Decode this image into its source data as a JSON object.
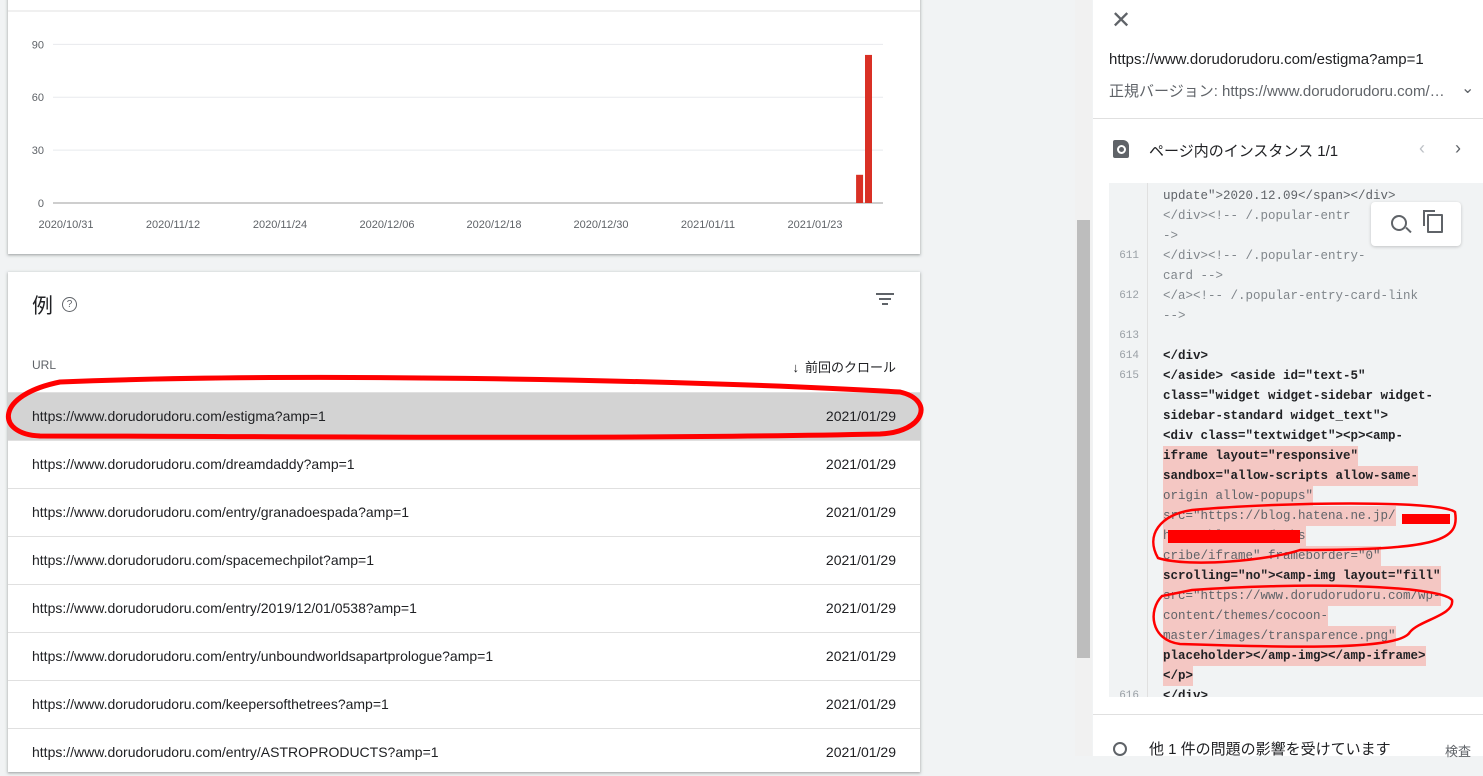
{
  "chart_data": {
    "type": "bar",
    "x_ticks": [
      "2020/10/31",
      "2020/11/12",
      "2020/11/24",
      "2020/12/06",
      "2020/12/18",
      "2020/12/30",
      "2021/01/11",
      "2021/01/23"
    ],
    "y_ticks": [
      "0",
      "30",
      "60",
      "90"
    ],
    "ylim": [
      0,
      97
    ],
    "bars": [
      {
        "date": "2021/01/28",
        "value": 16
      },
      {
        "date": "2021/01/29",
        "value": 84
      }
    ],
    "bar_color": "#d93025"
  },
  "examples": {
    "title": "例",
    "help_icon": "help-circle-icon",
    "filter_icon": "filter-icon",
    "col_url": "URL",
    "col_crawl": "前回のクロール",
    "rows": [
      {
        "url": "https://www.dorudorudoru.com/estigma?amp=1",
        "date": "2021/01/29"
      },
      {
        "url": "https://www.dorudorudoru.com/dreamdaddy?amp=1",
        "date": "2021/01/29"
      },
      {
        "url": "https://www.dorudorudoru.com/entry/granadoespada?amp=1",
        "date": "2021/01/29"
      },
      {
        "url": "https://www.dorudorudoru.com/spacemechpilot?amp=1",
        "date": "2021/01/29"
      },
      {
        "url": "https://www.dorudorudoru.com/entry/2019/12/01/0538?amp=1",
        "date": "2021/01/29"
      },
      {
        "url": "https://www.dorudorudoru.com/entry/unboundworldsapartprologue?amp=1",
        "date": "2021/01/29"
      },
      {
        "url": "https://www.dorudorudoru.com/keepersofthetrees?amp=1",
        "date": "2021/01/29"
      },
      {
        "url": "https://www.dorudorudoru.com/entry/ASTROPRODUCTS?amp=1",
        "date": "2021/01/29"
      }
    ]
  },
  "panel": {
    "url": "https://www.dorudorudoru.com/estigma?amp=1",
    "canonical": "正規バージョン: https://www.dorudorudoru.com/estigma",
    "instances_title": "ページ内のインスタンス 1/1",
    "other_issue": "他 1 件の問題の影響を受けています",
    "inspect": "検査"
  },
  "code": {
    "l_update": "update\">2020.12.09</span></div>",
    "l_div_comment": " </div><!-- /.popular-entr",
    "l_arrow": "->",
    "n611": "611",
    "l611a": "        </div><!-- /.popular-entry-",
    "l611b": "card -->",
    "n612": "612",
    "l612a": "  </a><!-- /.popular-entry-card-link",
    "l612b": "-->",
    "n613": "613",
    "n614": "614",
    "l614": "    </div>",
    "n615": "615",
    "l615a": "</aside>      <aside id=\"text-5\"",
    "l615b": "class=\"widget widget-sidebar widget-",
    "l615c": "sidebar-standard widget_text\">",
    "l615d": "    <div class=\"textwidget\"><p><amp-",
    "l615e": "iframe layout=\"responsive\"",
    "l615f": "sandbox=\"allow-scripts allow-same-",
    "l615g": "origin allow-popups\"",
    "l615h": "src=\"https://blog.hatena.ne.jp/",
    "l615i": "              hatenablog.com/subs",
    "l615j": "cribe/iframe\" frameborder=\"0\"",
    "l615k": "scrolling=\"no\"><amp-img layout=\"fill\"",
    "l615l": "src=\"https://www.dorudorudoru.com/wp-",
    "l615m": "content/themes/cocoon-",
    "l615n": "master/images/transparence.png\"",
    "l615o": "placeholder></amp-img></amp-iframe>",
    "l615p": "</p>",
    "n616": "616",
    "l616": "</div>"
  }
}
